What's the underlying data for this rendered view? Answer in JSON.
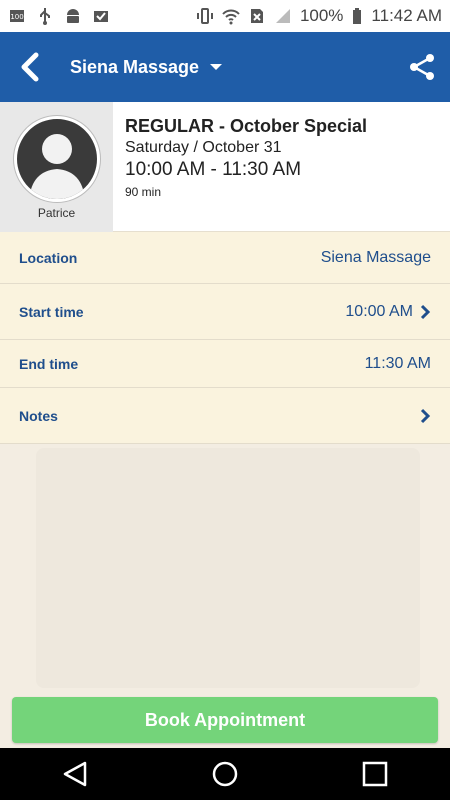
{
  "status_bar": {
    "battery": "100%",
    "time": "11:42 AM"
  },
  "app_bar": {
    "title": "Siena Massage"
  },
  "header": {
    "provider_name": "Patrice",
    "title": "REGULAR - October Special",
    "date": "Saturday / October 31",
    "time": "10:00 AM - 11:30 AM",
    "duration": "90 min"
  },
  "details": {
    "location_label": "Location",
    "location_value": "Siena Massage",
    "start_label": "Start time",
    "start_value": "10:00 AM",
    "end_label": "End time",
    "end_value": "11:30 AM",
    "notes_label": "Notes"
  },
  "book_button": "Book Appointment",
  "colors": {
    "primary": "#1f5da8",
    "accent": "#74d47a",
    "rows_bg": "#faf3de"
  }
}
